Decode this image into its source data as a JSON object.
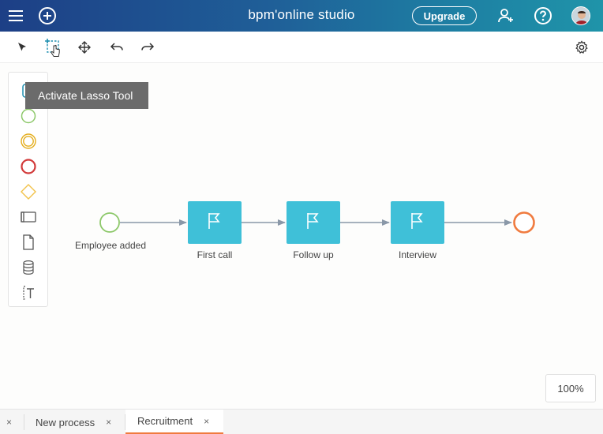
{
  "header": {
    "brand": "bpm'online studio",
    "upgrade_label": "Upgrade",
    "icons": [
      "menu-icon",
      "add-circle-icon",
      "add-user-icon",
      "help-icon"
    ]
  },
  "toolbar": {
    "tools": [
      "pointer-icon",
      "lasso-icon",
      "move-icon",
      "undo-icon",
      "redo-icon",
      "settings-icon"
    ]
  },
  "tooltip": {
    "text": "Activate Lasso Tool"
  },
  "palette": {
    "items": [
      "lane-icon",
      "start-event-icon",
      "intermediate-event-icon",
      "end-event-icon",
      "gateway-icon",
      "task-icon",
      "data-object-icon",
      "data-store-icon",
      "text-annotation-icon"
    ]
  },
  "diagram": {
    "start_label": "Employee added",
    "tasks": [
      {
        "label": "First call"
      },
      {
        "label": "Follow up"
      },
      {
        "label": "Interview"
      }
    ],
    "colors": {
      "start": "#8dc86a",
      "task": "#3fc0d8",
      "end": "#f07b3f",
      "flow": "#8a98a8"
    }
  },
  "zoom": {
    "level": "100%"
  },
  "tabs": [
    {
      "label": "New process",
      "active": false
    },
    {
      "label": "Recruitment",
      "active": true
    }
  ],
  "tab_close": "×"
}
